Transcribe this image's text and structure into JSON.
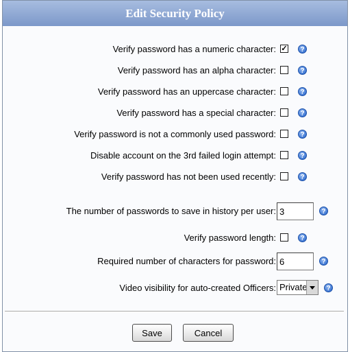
{
  "dialog": {
    "title": "Edit Security Policy"
  },
  "rows": [
    {
      "label": "Verify password has a numeric character:",
      "checked": true
    },
    {
      "label": "Verify password has an alpha character:",
      "checked": false
    },
    {
      "label": "Verify password has an uppercase character:",
      "checked": false
    },
    {
      "label": "Verify password has a special character:",
      "checked": false
    },
    {
      "label": "Verify password is not a commonly used password:",
      "checked": false
    },
    {
      "label": "Disable account on the 3rd failed login attempt:",
      "checked": false
    },
    {
      "label": "Verify password has not been used recently:",
      "checked": false
    },
    {
      "label": "The number of passwords to save in history per user:",
      "value": "3"
    },
    {
      "label": "Verify password length:",
      "checked": false
    },
    {
      "label": "Required number of characters for password:",
      "value": "6"
    },
    {
      "label": "Video visibility for auto-created Officers:",
      "selected": "Private"
    }
  ],
  "help_icon": "question-mark-icon",
  "buttons": {
    "save": "Save",
    "cancel": "Cancel"
  },
  "colors": {
    "title_bar": "#8ba6d4",
    "help_icon": "#2e6fd6"
  }
}
